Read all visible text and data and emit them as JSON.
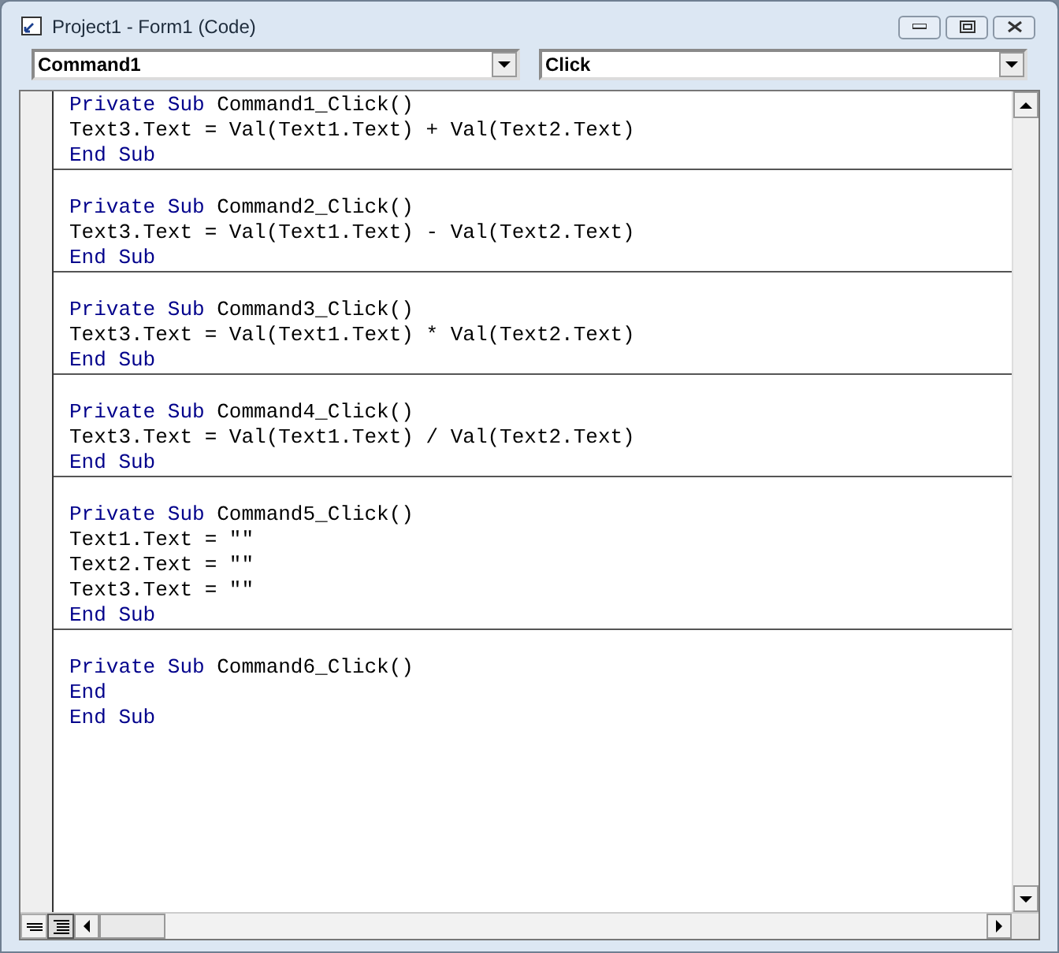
{
  "window": {
    "title": "Project1 - Form1 (Code)"
  },
  "object_combo": {
    "value": "Command1"
  },
  "procedure_combo": {
    "value": "Click"
  },
  "procedures": [
    {
      "lines": [
        [
          {
            "kind": "keyword",
            "text": "Private Sub"
          },
          {
            "kind": "plain",
            "text": " Command1_Click()"
          }
        ],
        [
          {
            "kind": "plain",
            "text": "Text3.Text = Val(Text1.Text) + Val(Text2.Text)"
          }
        ],
        [
          {
            "kind": "keyword",
            "text": "End Sub"
          }
        ]
      ]
    },
    {
      "lines": [
        [
          {
            "kind": "keyword",
            "text": "Private Sub"
          },
          {
            "kind": "plain",
            "text": " Command2_Click()"
          }
        ],
        [
          {
            "kind": "plain",
            "text": "Text3.Text = Val(Text1.Text) - Val(Text2.Text)"
          }
        ],
        [
          {
            "kind": "keyword",
            "text": "End Sub"
          }
        ]
      ]
    },
    {
      "lines": [
        [
          {
            "kind": "keyword",
            "text": "Private Sub"
          },
          {
            "kind": "plain",
            "text": " Command3_Click()"
          }
        ],
        [
          {
            "kind": "plain",
            "text": "Text3.Text = Val(Text1.Text) * Val(Text2.Text)"
          }
        ],
        [
          {
            "kind": "keyword",
            "text": "End Sub"
          }
        ]
      ]
    },
    {
      "lines": [
        [
          {
            "kind": "keyword",
            "text": "Private Sub"
          },
          {
            "kind": "plain",
            "text": " Command4_Click()"
          }
        ],
        [
          {
            "kind": "plain",
            "text": "Text3.Text = Val(Text1.Text) / Val(Text2.Text)"
          }
        ],
        [
          {
            "kind": "keyword",
            "text": "End Sub"
          }
        ]
      ]
    },
    {
      "lines": [
        [
          {
            "kind": "keyword",
            "text": "Private Sub"
          },
          {
            "kind": "plain",
            "text": " Command5_Click()"
          }
        ],
        [
          {
            "kind": "plain",
            "text": "Text1.Text = \"\""
          }
        ],
        [
          {
            "kind": "plain",
            "text": "Text2.Text = \"\""
          }
        ],
        [
          {
            "kind": "plain",
            "text": "Text3.Text = \"\""
          }
        ],
        [
          {
            "kind": "keyword",
            "text": "End Sub"
          }
        ]
      ]
    },
    {
      "lines": [
        [
          {
            "kind": "keyword",
            "text": "Private Sub"
          },
          {
            "kind": "plain",
            "text": " Command6_Click()"
          }
        ],
        [
          {
            "kind": "keyword",
            "text": "End"
          }
        ],
        [
          {
            "kind": "keyword",
            "text": "End Sub"
          }
        ]
      ]
    }
  ],
  "view_buttons": [
    {
      "kind": "procedure",
      "selected": false
    },
    {
      "kind": "full_module",
      "selected": true
    }
  ]
}
